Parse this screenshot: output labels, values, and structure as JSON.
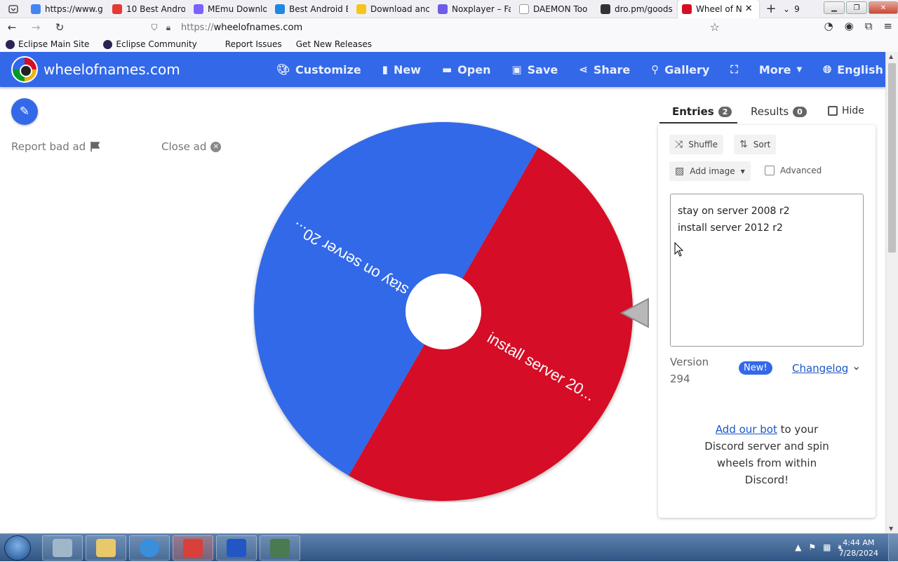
{
  "browser": {
    "tabs": [
      {
        "title": "https://www.g",
        "color": "#4285f4"
      },
      {
        "title": "10 Best Andro",
        "color": "#e53935"
      },
      {
        "title": "MEmu Downlo",
        "color": "#7b61ff"
      },
      {
        "title": "Best Android E",
        "color": "#1e88e5"
      },
      {
        "title": "Download anc",
        "color": "#f5c518"
      },
      {
        "title": "Noxplayer – Fa",
        "color": "#6c5ce7"
      },
      {
        "title": "DAEMON Too",
        "color": "#ffffff"
      },
      {
        "title": "dro.pm/goods",
        "color": "#333333"
      },
      {
        "title": "Wheel of N",
        "color": "#d50f25",
        "active": true
      }
    ],
    "tab_count": "9",
    "url_protocol": "https://",
    "url_host": "wheelofnames.com",
    "bookmarks": [
      "Eclipse Main Site",
      "Eclipse Community",
      "Report Issues",
      "Get New Releases"
    ]
  },
  "site": {
    "name": "wheelofnames.com",
    "menu": [
      {
        "icon": "palette-icon",
        "label": "Customize"
      },
      {
        "icon": "file-icon",
        "label": "New"
      },
      {
        "icon": "folder-open-icon",
        "label": "Open"
      },
      {
        "icon": "save-icon",
        "label": "Save"
      },
      {
        "icon": "share-icon",
        "label": "Share"
      },
      {
        "icon": "search-icon",
        "label": "Gallery"
      },
      {
        "icon": "fullscreen-icon",
        "label": ""
      },
      {
        "icon": "chevron-down-icon",
        "label": "More"
      },
      {
        "icon": "globe-icon",
        "label": "English"
      }
    ]
  },
  "ads": {
    "report_label": "Report bad ad",
    "close_label": "Close ad"
  },
  "wheel": {
    "slices": [
      {
        "label": "install server 20...",
        "color": "#d50f25"
      },
      {
        "label": "stay on server 20...",
        "color": "#3369e8"
      }
    ]
  },
  "panel": {
    "tabs": [
      {
        "label": "Entries",
        "count": "2"
      },
      {
        "label": "Results",
        "count": "0"
      }
    ],
    "hide_label": "Hide",
    "shuffle_label": "Shuffle",
    "sort_label": "Sort",
    "add_image_label": "Add image",
    "advanced_label": "Advanced",
    "entries": [
      "stay on server 2008 r2",
      "install server 2012 r2"
    ],
    "version_label": "Version",
    "version_number": "294",
    "new_badge": "New!",
    "changelog_label": "Changelog",
    "discord_link": "Add our bot",
    "discord_text": "to your Discord server and spin wheels from within Discord!"
  },
  "taskbar": {
    "apps": [
      {
        "name": "server-manager",
        "color": "#9fb7c9"
      },
      {
        "name": "file-explorer",
        "color": "#e8c86a"
      },
      {
        "name": "internet-explorer",
        "color": "#3a8fdc"
      },
      {
        "name": "toolbox",
        "color": "#d9403a"
      },
      {
        "name": "malwarebytes",
        "color": "#2156c4"
      },
      {
        "name": "command-prompt",
        "color": "#4a7a50"
      }
    ],
    "time": "4:44 AM",
    "date": "7/28/2024"
  }
}
